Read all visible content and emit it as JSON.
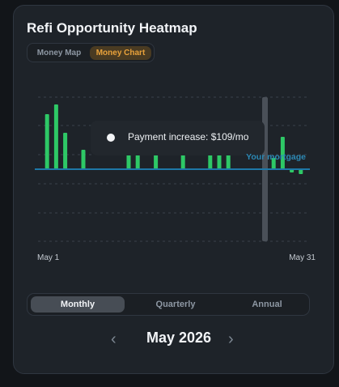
{
  "card": {
    "title": "Refi Opportunity Heatmap"
  },
  "view_toggle": {
    "options": [
      "Money Map",
      "Money Chart"
    ],
    "selected": "Money Chart"
  },
  "tooltip": {
    "text": "Payment increase: $109/mo"
  },
  "period_toggle": {
    "options": [
      "Monthly",
      "Quarterly",
      "Annual"
    ],
    "selected": "Monthly"
  },
  "month_nav": {
    "label": "May 2026",
    "prev_icon": "chevron-left-icon",
    "next_icon": "chevron-right-icon"
  },
  "colors": {
    "card_bg": "#1e2329",
    "bar_green": "#2ec866",
    "reference_blue": "#1e78a8",
    "reference_label": "#2c89b5",
    "accent_orange": "#e9a23b",
    "highlight_band": "#4a5058"
  },
  "chart_data": {
    "type": "bar",
    "x_start_label": "May 1",
    "x_end_label": "May 31",
    "x_range": [
      1,
      31
    ],
    "reference_line": {
      "label": "Your mortgage",
      "value": 0
    },
    "highlighted_day": 26,
    "grid": true,
    "x": [
      2,
      3,
      4,
      6,
      11,
      12,
      14,
      17,
      20,
      21,
      22,
      27,
      28,
      29,
      30
    ],
    "values": [
      68,
      80,
      45,
      24,
      26,
      22,
      40,
      26,
      20,
      50,
      28,
      14,
      40,
      -4,
      -6
    ]
  }
}
